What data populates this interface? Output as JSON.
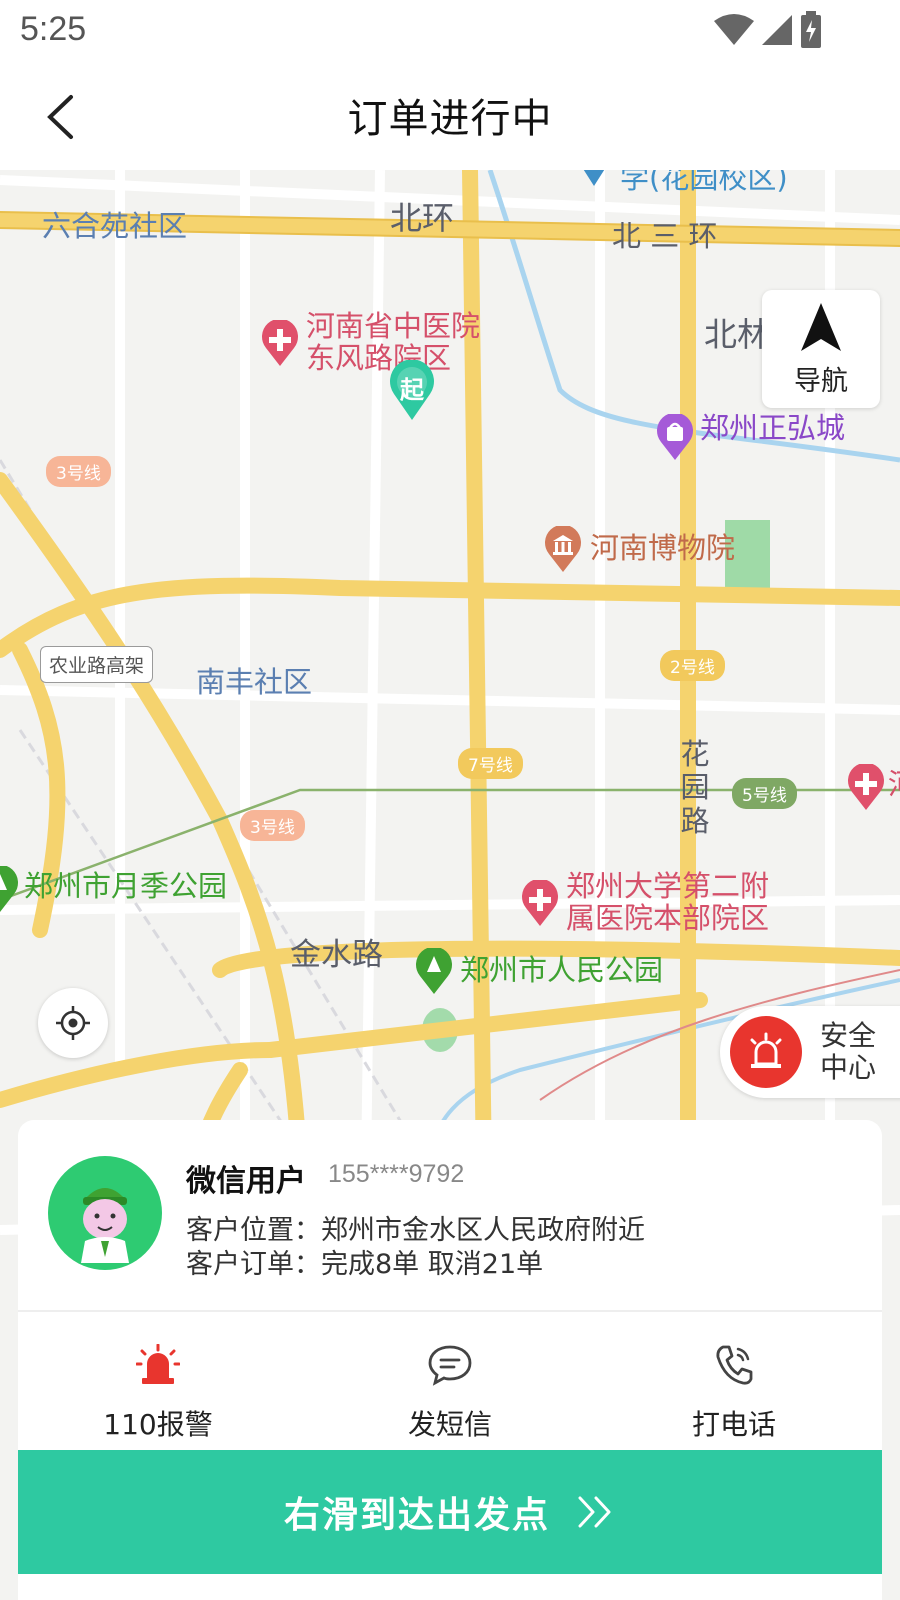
{
  "status_bar": {
    "time": "5:25"
  },
  "header": {
    "title": "订单进行中"
  },
  "map": {
    "labels": {
      "liuheyuan": "六合苑社区",
      "beihuan": "北环",
      "beisanhuan": "北 三 环",
      "school": "学(花园校区)",
      "beilin": "北林",
      "hospital_1a": "河南省中医院",
      "hospital_1b": "东风路院区",
      "mall": "郑州正弘城",
      "museum": "河南博物院",
      "nongye_elevated": "农业路高架",
      "nanfeng": "南丰社区",
      "huayuan_road": "花园路",
      "hospital_2a": "郑州大学第二附",
      "hospital_2b": "属医院本部院区",
      "yueji_park": "郑州市月季公园",
      "jinshui_road": "金水路",
      "people_park": "郑州市人民公园",
      "start_marker": "起",
      "edge_hospital": "河"
    },
    "metro_badges": {
      "line3_a": "3号线",
      "line3_b": "3号线",
      "line2": "2号线",
      "line7": "7号线",
      "line5": "5号线"
    },
    "nav_button": {
      "label": "导航"
    },
    "safety_center": {
      "label": "安全中心"
    }
  },
  "customer": {
    "name": "微信用户",
    "phone": "155****9792",
    "location": "客户位置：郑州市金水区人民政府附近",
    "orders": "客户订单：完成8单 取消21单"
  },
  "actions": {
    "police": "110报警",
    "sms": "发短信",
    "call": "打电话"
  },
  "slide": {
    "label": "右滑到达出发点"
  },
  "colors": {
    "accent": "#2ec9a1",
    "alarm_red": "#e8352e",
    "road_yellow": "#f5d36e"
  }
}
